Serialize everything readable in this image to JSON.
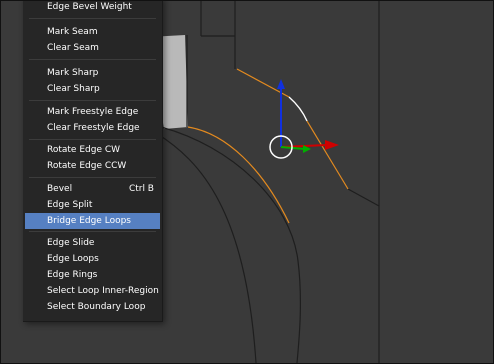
{
  "colors": {
    "viewport_bg": "#3a3a3a",
    "menu_bg": "#262626",
    "menu_text": "#ffffff",
    "menu_highlight": "#5680c2",
    "edge_selected": "#e38a1f",
    "edge_active": "#ffffff",
    "gizmo_x": "#d00000",
    "gizmo_y": "#00b000",
    "gizmo_z": "#1030e0",
    "face_light": "#b9b9b9"
  },
  "menu": {
    "items": [
      {
        "label": "Edge Bevel Weight",
        "shortcut": ""
      },
      {
        "label": "Mark Seam",
        "shortcut": ""
      },
      {
        "label": "Clear Seam",
        "shortcut": ""
      },
      {
        "label": "Mark Sharp",
        "shortcut": ""
      },
      {
        "label": "Clear Sharp",
        "shortcut": ""
      },
      {
        "label": "Mark Freestyle Edge",
        "shortcut": ""
      },
      {
        "label": "Clear Freestyle Edge",
        "shortcut": ""
      },
      {
        "label": "Rotate Edge CW",
        "shortcut": ""
      },
      {
        "label": "Rotate Edge CCW",
        "shortcut": ""
      },
      {
        "label": "Bevel",
        "shortcut": "Ctrl B"
      },
      {
        "label": "Edge Split",
        "shortcut": ""
      },
      {
        "label": "Bridge Edge Loops",
        "shortcut": ""
      },
      {
        "label": "Edge Slide",
        "shortcut": ""
      },
      {
        "label": "Edge Loops",
        "shortcut": ""
      },
      {
        "label": "Edge Rings",
        "shortcut": ""
      },
      {
        "label": "Select Loop Inner-Region",
        "shortcut": ""
      },
      {
        "label": "Select Boundary Loop",
        "shortcut": ""
      }
    ],
    "selected_label": "Bridge Edge Loops",
    "icons": {
      "transform_gizmo": "transform-gizmo-icon",
      "pivot": "pivot-circle-icon"
    }
  }
}
